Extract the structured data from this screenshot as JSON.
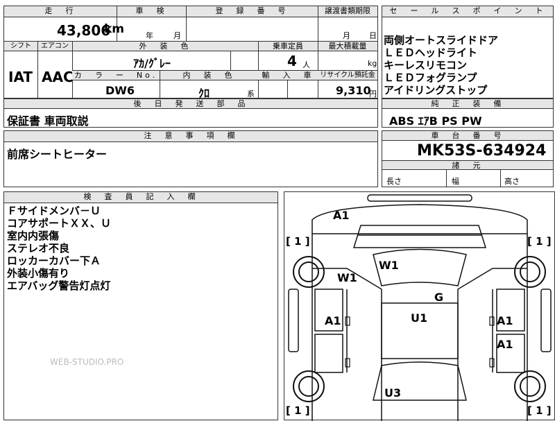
{
  "top_table": {
    "mileage_header": "走　行",
    "mileage_value": "43,806",
    "mileage_unit": "km",
    "inspection_header": "車　検",
    "inspection_year": "年",
    "inspection_month": "月",
    "registration_header": "登　録　番　号",
    "transfer_header": "譲渡書類期限",
    "transfer_month": "月",
    "transfer_day": "日",
    "shift_header": "シフト",
    "aircon_header": "エアコン",
    "shift_value": "IAT",
    "aircon_value": "AAC",
    "exterior_color_header": "外　装　色",
    "exterior_color_value": "ｱｶ/ｸﾞﾚｰ",
    "capacity_header": "乗車定員",
    "capacity_value": "4",
    "capacity_unit": "人",
    "max_load_header": "最大積載量",
    "max_load_unit": "kg",
    "color_no_header": "カ　ラ　ー　No.",
    "color_no_value": "DW6",
    "interior_color_header": "内　装　色",
    "interior_color_value": "ｸﾛ",
    "interior_color_suffix": "系",
    "import_header": "輸　入　車",
    "recycle_header": "リサイクル預託金",
    "recycle_value": "9,310",
    "recycle_unit": "円",
    "later_parts_header": "後　日　発　送　部　品",
    "later_parts_value": "保証書 車両取説",
    "notes_header": "注　意　事　項　欄",
    "notes_value": "前席シートヒーター"
  },
  "sales_points": {
    "header": "セ　ー　ル　ス　ポ　イ　ン　ト",
    "items": [
      "両側オートスライドドア",
      "ＬＥＤヘッドライト",
      "キーレスリモコン",
      "ＬＥＤフォグランプ",
      "アイドリングストップ"
    ]
  },
  "genuine_equipment": {
    "header": "純　正　装　備",
    "value": "ABS ｴｱB PS PW"
  },
  "chassis": {
    "header": "車　台　番　号",
    "value": "MK53S-634924"
  },
  "dimensions": {
    "header": "諸　元",
    "length_label": "長さ",
    "width_label": "幅",
    "height_label": "高さ"
  },
  "inspector_notes": {
    "header": "検　査　員　記　入　欄",
    "lines": [
      "Ｆサイドメンバ－Ｕ",
      "コアサポートＸＸ、Ｕ",
      "室内内張傷",
      "ステレオ不良",
      "ロッカーカバー下Ａ",
      "外装小傷有り",
      "エアバッグ警告灯点灯"
    ],
    "watermark": "WEB-STUDIO.PRO"
  },
  "diagram": {
    "marks": {
      "front_top": "A1",
      "hood_left": "W1",
      "windshield": "W1",
      "roof_g": "G",
      "roof_u": "U1",
      "left_door": "A1",
      "right_door_front": "A1",
      "right_door_rear": "A1",
      "rear": "U3",
      "bracket_tl": "[ 1 ]",
      "bracket_tr": "[ 1 ]",
      "bracket_bl": "[ 1 ]",
      "bracket_br": "[ 1 ]"
    }
  }
}
